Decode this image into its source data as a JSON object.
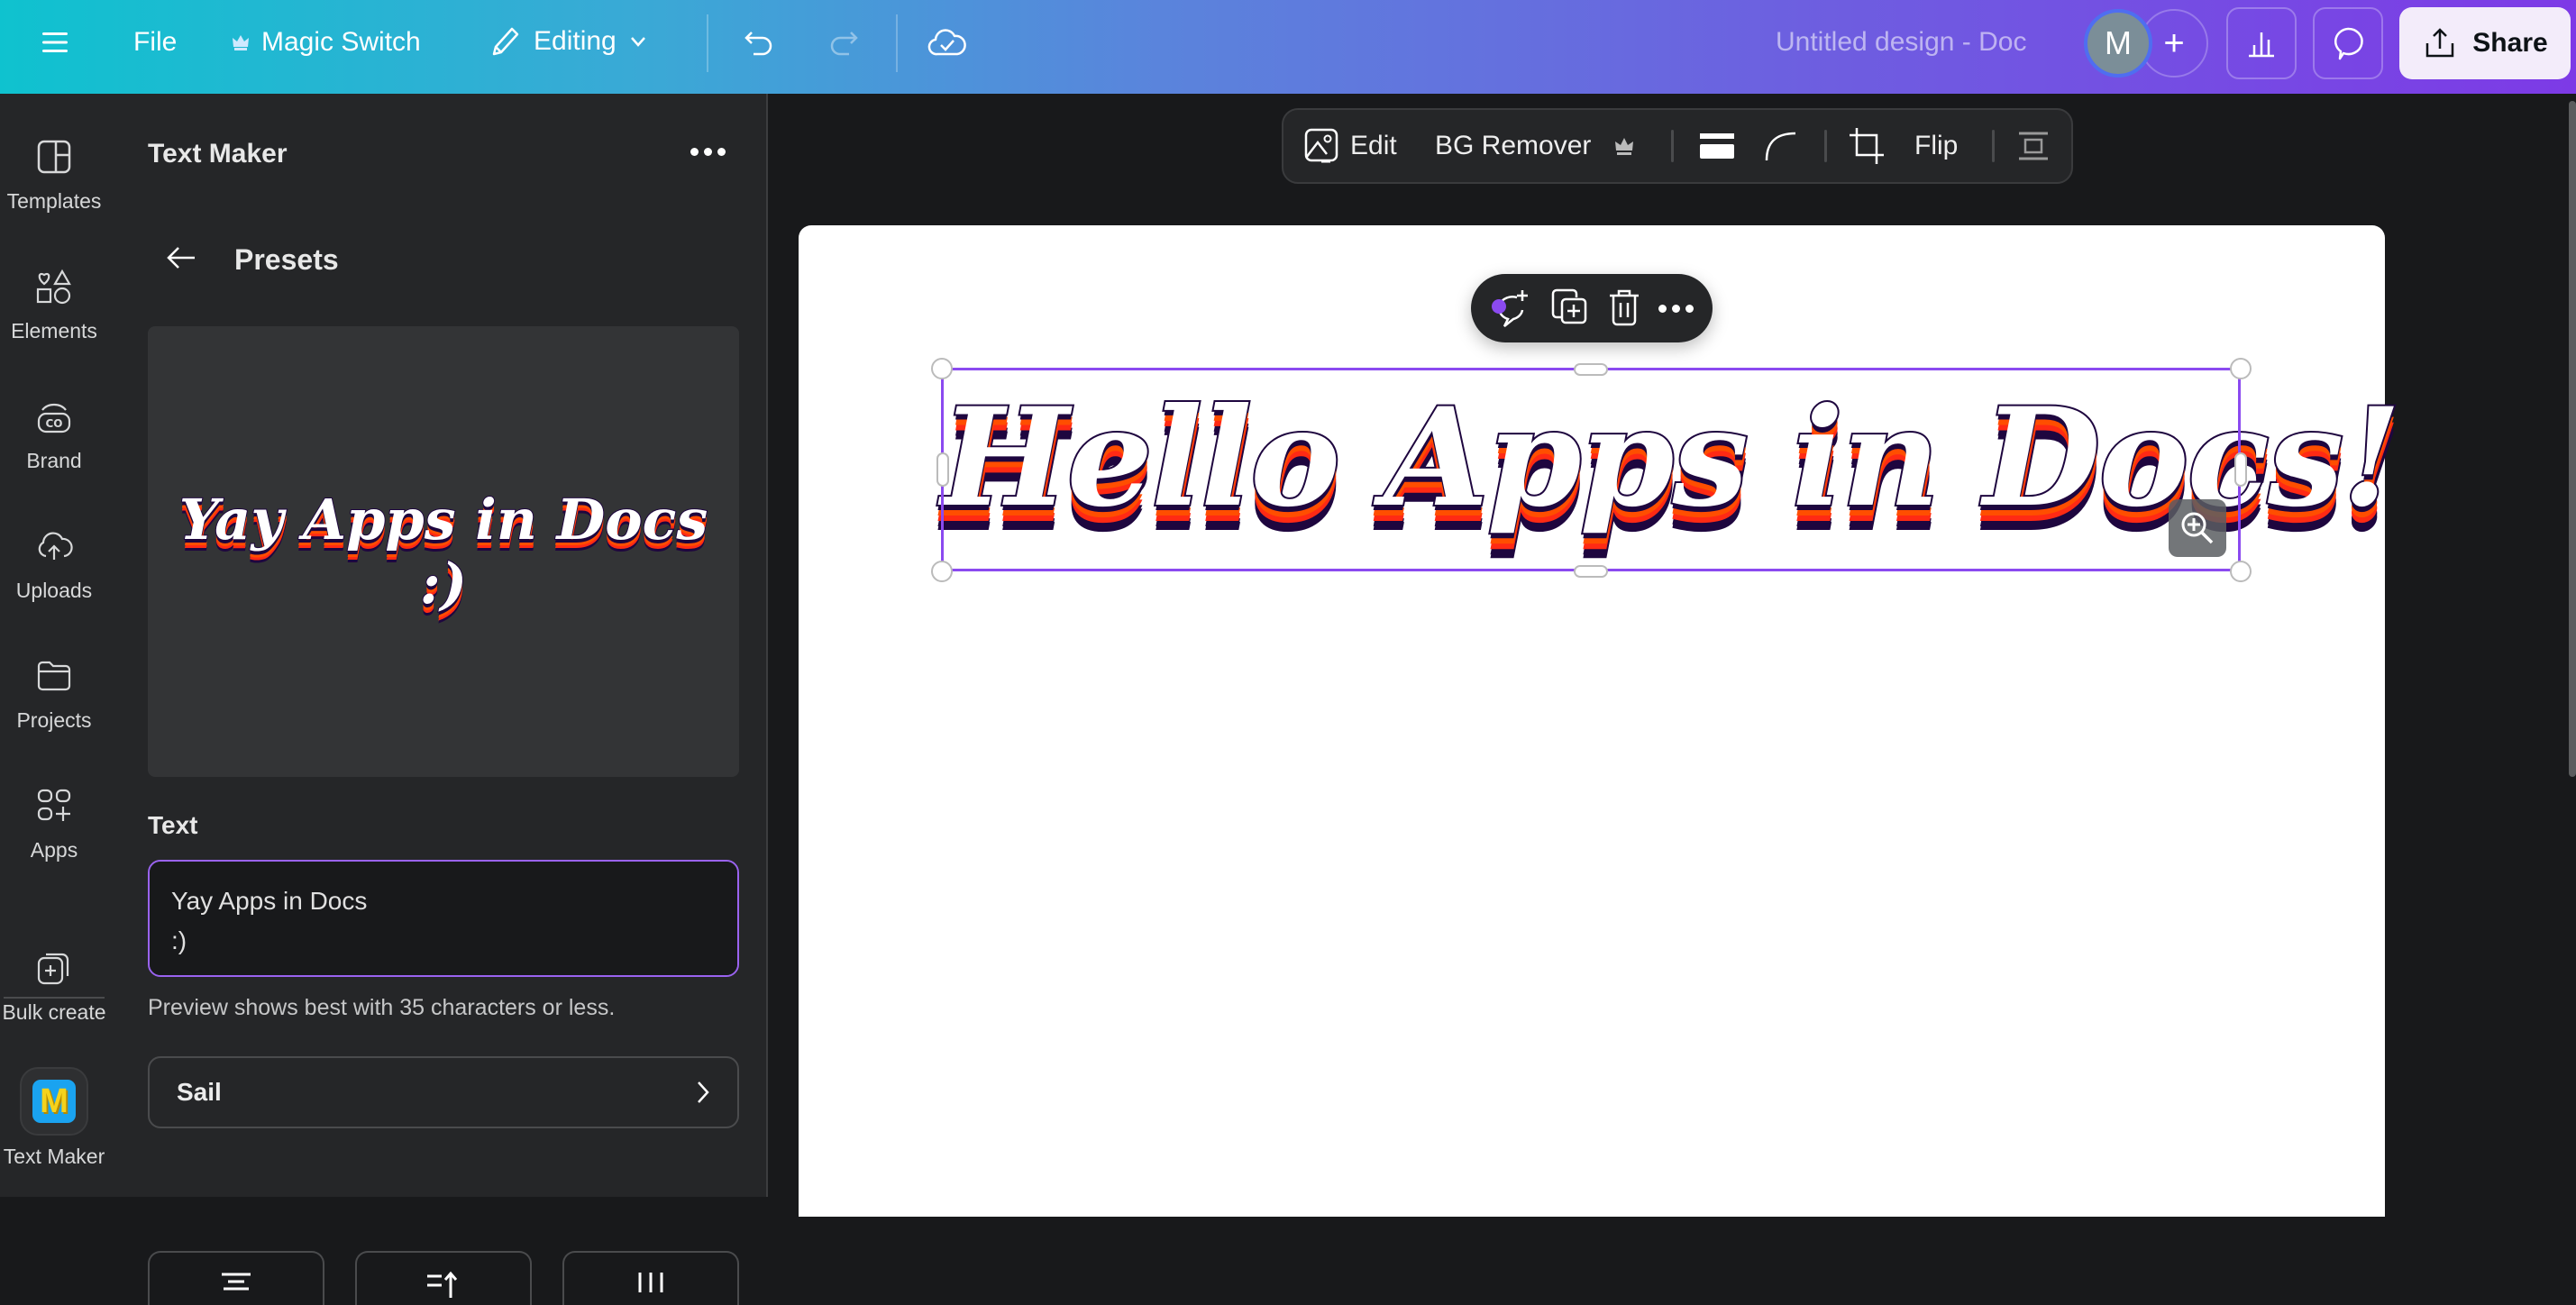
{
  "topbar": {
    "menu_icon": "hamburger-icon",
    "file_label": "File",
    "magic_switch_label": "Magic Switch",
    "magic_switch_icon": "crown-icon",
    "editing_label": "Editing",
    "editing_icon": "pencil-icon",
    "undo_icon": "undo-icon",
    "redo_icon": "redo-icon",
    "save_status_icon": "cloud-check-icon",
    "document_title": "Untitled design - Doc",
    "avatar_initial": "M",
    "add_collaborator_label": "+",
    "insights_icon": "bar-chart-icon",
    "comments_icon": "comment-icon",
    "share_label": "Share",
    "share_icon": "upload-icon"
  },
  "rail": {
    "items": [
      {
        "label": "Templates",
        "icon": "templates-icon"
      },
      {
        "label": "Elements",
        "icon": "elements-icon"
      },
      {
        "label": "Brand",
        "icon": "brand-icon"
      },
      {
        "label": "Uploads",
        "icon": "cloud-upload-icon"
      },
      {
        "label": "Projects",
        "icon": "folder-icon"
      },
      {
        "label": "Apps",
        "icon": "apps-icon"
      },
      {
        "label": "Bulk create",
        "icon": "bulk-create-icon"
      },
      {
        "label": "Text Maker",
        "icon": "text-maker-app-icon",
        "app_letter": "M"
      }
    ]
  },
  "panel": {
    "title": "Text Maker",
    "subtitle": "Presets",
    "preview_text": "Yay Apps in Docs\n:)",
    "text_section_label": "Text",
    "text_value": "Yay Apps in Docs\n:)",
    "hint": "Preview shows best with 35 characters or less.",
    "font_value": "Sail",
    "option_buttons": [
      {
        "icon": "align-center-icon"
      },
      {
        "icon": "line-spacing-icon"
      },
      {
        "icon": "letter-spacing-icon"
      }
    ]
  },
  "context_toolbar": {
    "edit_label": "Edit",
    "bg_remover_label": "BG Remover",
    "flip_label": "Flip"
  },
  "canvas": {
    "text": "Hello Apps in Docs!",
    "colors": {
      "fill": "#ffffff",
      "outline": "#1e063f",
      "shadow_1": "#ff4e00",
      "shadow_2": "#ff2a14",
      "selection": "#8b4af0"
    }
  }
}
